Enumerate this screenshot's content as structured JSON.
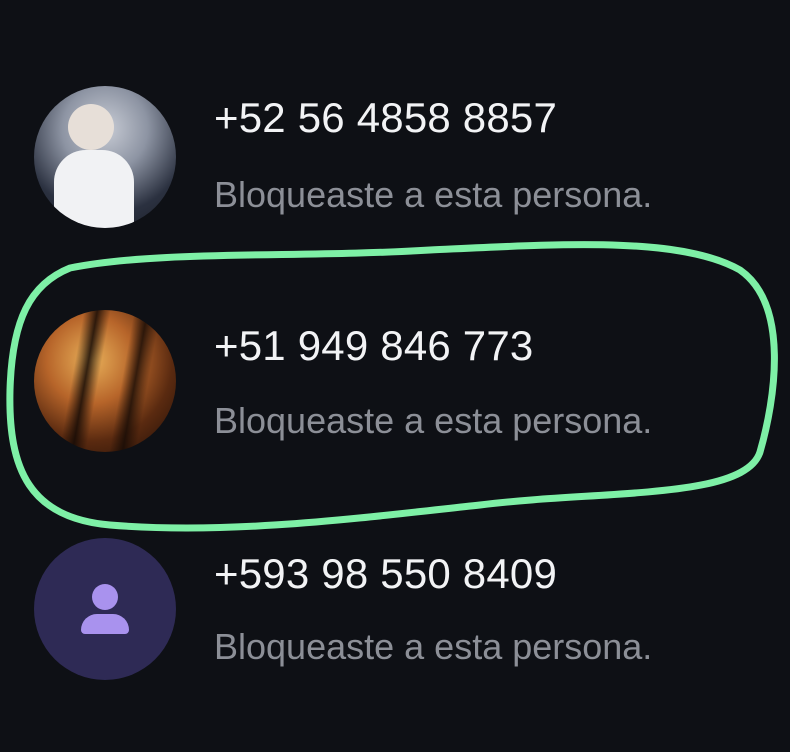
{
  "contacts": [
    {
      "phone": "+52 56 4858 8857",
      "status": "Bloqueaste a esta persona.",
      "avatar": "photo"
    },
    {
      "phone": "+51 949 846 773",
      "status": "Bloqueaste a esta persona.",
      "avatar": "photo",
      "highlighted": true
    },
    {
      "phone": "+593 98 550 8409",
      "status": "Bloqueaste a esta persona.",
      "avatar": "person-icon"
    }
  ],
  "colors": {
    "background": "#0e1015",
    "phone_text": "#f2f3f5",
    "status_text": "#8c8f97",
    "highlight_outline": "#7ef0a6",
    "default_avatar_bg": "#2e2a55",
    "default_avatar_icon": "#a992ee"
  }
}
